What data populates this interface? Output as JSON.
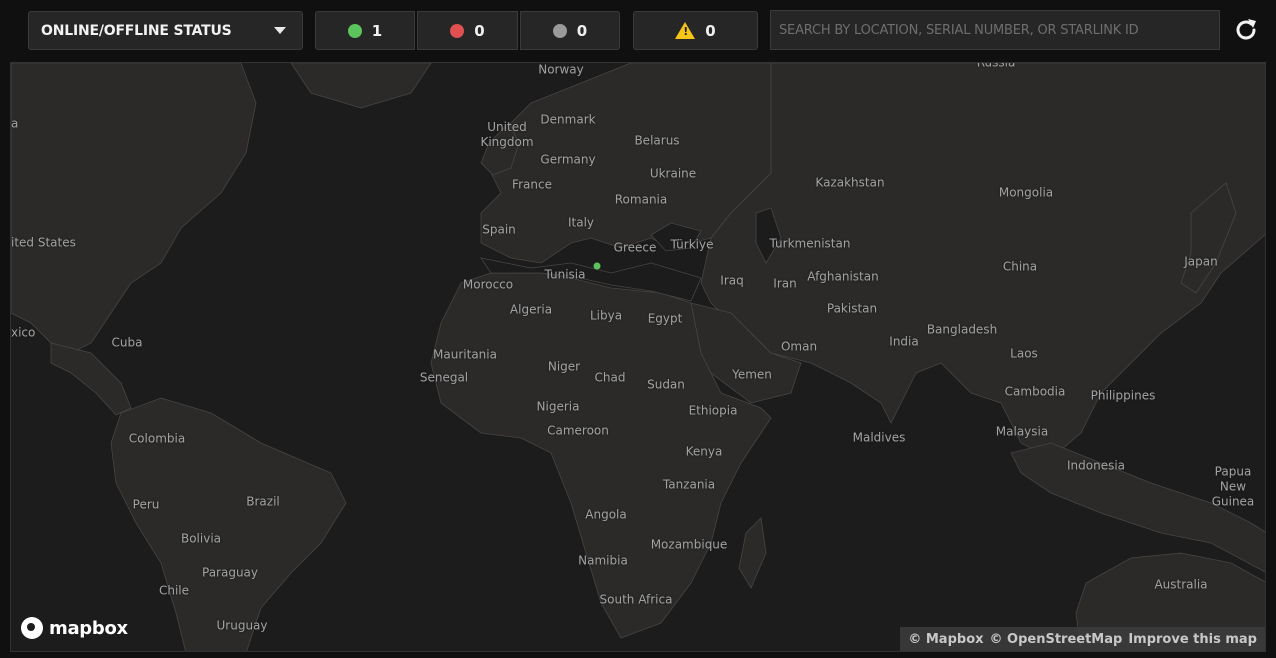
{
  "filter": {
    "label": "ONLINE/OFFLINE STATUS"
  },
  "counts": {
    "online": {
      "value": "1",
      "color": "#5cc45c"
    },
    "offline": {
      "value": "0",
      "color": "#e05050"
    },
    "unknown": {
      "value": "0",
      "color": "#9a9a9a"
    },
    "alerts": {
      "value": "0",
      "color": "#f5c518"
    }
  },
  "search": {
    "placeholder": "SEARCH BY LOCATION, SERIAL NUMBER, OR STARLINK ID"
  },
  "refresh_icon": "refresh-icon",
  "map": {
    "labels": {
      "norway": "Norway",
      "russia": "Russia",
      "united_kingdom": "United\nKingdom",
      "denmark": "Denmark",
      "belarus": "Belarus",
      "germany": "Germany",
      "ukraine": "Ukraine",
      "france": "France",
      "romania": "Romania",
      "kazakhstan": "Kazakhstan",
      "mongolia": "Mongolia",
      "italy": "Italy",
      "spain": "Spain",
      "greece": "Greece",
      "turkiye": "Türkiye",
      "turkmenistan": "Turkmenistan",
      "united_states": "ited States",
      "tunisia": "Tunisia",
      "china": "China",
      "japan": "Japan",
      "morocco": "Morocco",
      "iraq": "Iraq",
      "iran": "Iran",
      "afghanistan": "Afghanistan",
      "algeria": "Algeria",
      "pakistan": "Pakistan",
      "libya": "Libya",
      "egypt": "Egypt",
      "mexico": "xico",
      "bangladesh": "Bangladesh",
      "cuba": "Cuba",
      "india": "India",
      "oman": "Oman",
      "laos": "Laos",
      "mauritania": "Mauritania",
      "niger": "Niger",
      "senegal": "Senegal",
      "chad": "Chad",
      "sudan": "Sudan",
      "yemen": "Yemen",
      "cambodia": "Cambodia",
      "philippines": "Philippines",
      "nigeria": "Nigeria",
      "ethiopia": "Ethiopia",
      "cameroon": "Cameroon",
      "colombia": "Colombia",
      "maldives": "Maldives",
      "malaysia": "Malaysia",
      "kenya": "Kenya",
      "indonesia": "Indonesia",
      "tanzania": "Tanzania",
      "papua_new_guinea": "Papua New\nGuinea",
      "brazil": "Brazil",
      "peru": "Peru",
      "angola": "Angola",
      "bolivia": "Bolivia",
      "mozambique": "Mozambique",
      "namibia": "Namibia",
      "paraguay": "Paraguay",
      "australia": "Australia",
      "chile": "Chile",
      "south_africa": "South Africa",
      "uruguay": "Uruguay",
      "a_edge": "a"
    },
    "logo_text": "mapbox",
    "attribution": {
      "mapbox": "© Mapbox",
      "osm": "© OpenStreetMap",
      "improve": "Improve this map"
    }
  }
}
